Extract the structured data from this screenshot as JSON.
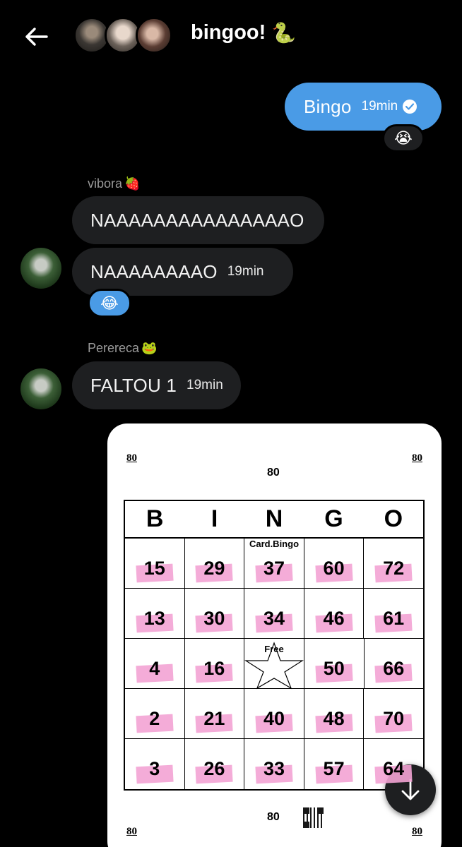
{
  "header": {
    "title": "bingoo!",
    "title_emoji": "🐍",
    "back_icon": "arrow-left-icon",
    "participants": [
      "participant-1",
      "participant-2",
      "participant-3"
    ]
  },
  "messages": [
    {
      "sender": "me",
      "text": "Bingo",
      "time": "19min",
      "status_icon": "check-circle-icon",
      "reaction": "😭"
    },
    {
      "sender_name": "vibora",
      "sender_emoji": "🍓",
      "text": "NAAAAAAAAAAAAAAAO"
    },
    {
      "sender_name": "vibora",
      "text": "NAAAAAAAAO",
      "time": "19min",
      "reaction": "😂"
    },
    {
      "sender_name": "Perereca",
      "sender_emoji": "🐸",
      "text": "FALTOU 1",
      "time": "19min"
    }
  ],
  "bingo_card": {
    "corner_label": "80",
    "center_label": "80",
    "header": [
      "B",
      "I",
      "N",
      "G",
      "O"
    ],
    "card_brand": "Card.Bingo",
    "free_label": "Free",
    "rows": [
      [
        "15",
        "29",
        "37",
        "60",
        "72"
      ],
      [
        "13",
        "30",
        "34",
        "46",
        "61"
      ],
      [
        "4",
        "16",
        "",
        "50",
        "66"
      ],
      [
        "2",
        "21",
        "40",
        "48",
        "70"
      ],
      [
        "3",
        "26",
        "33",
        "57",
        "64"
      ]
    ]
  },
  "scroll_button_icon": "arrow-down-icon",
  "colors": {
    "background": "#000000",
    "bubble_mine": "#4a9be6",
    "bubble_other": "#1e1f21",
    "highlight": "#f3a3d4"
  }
}
